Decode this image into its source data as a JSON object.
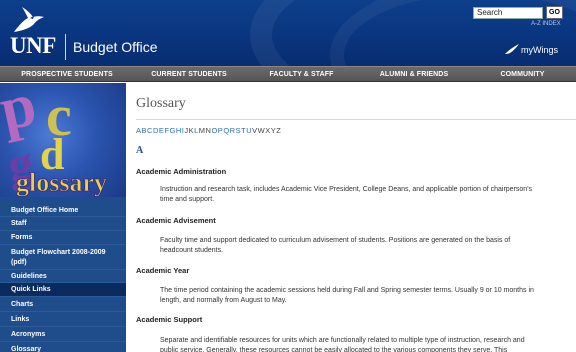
{
  "header": {
    "logo_text": "UNF",
    "site_title": "Budget Office",
    "search_value": "Search",
    "search_go": "GO",
    "az_index": "A-Z INDEX",
    "mywings": "myWings"
  },
  "nav": [
    "PROSPECTIVE STUDENTS",
    "CURRENT STUDENTS",
    "FACULTY & STAFF",
    "ALUMNI & FRIENDS",
    "COMMUNITY"
  ],
  "sidebar": {
    "banner_text": "glossary",
    "links": [
      "Budget Office Home",
      "Staff",
      "Forms",
      "Budget Flowchart 2008-2009 (pdf)",
      "Guidelines",
      "Quick Links",
      "Charts",
      "Links",
      "Acronyms",
      "Glossary"
    ],
    "highlighted": "Quick Links"
  },
  "main": {
    "title": "Glossary",
    "alphabet": [
      {
        "l": "A",
        "link": true
      },
      {
        "l": "B",
        "link": true
      },
      {
        "l": "C",
        "link": true
      },
      {
        "l": "D",
        "link": true
      },
      {
        "l": "E",
        "link": true
      },
      {
        "l": "F",
        "link": true
      },
      {
        "l": "G",
        "link": true
      },
      {
        "l": "H",
        "link": true
      },
      {
        "l": "I",
        "link": true
      },
      {
        "l": "J",
        "link": false
      },
      {
        "l": "K",
        "link": false
      },
      {
        "l": "L",
        "link": true
      },
      {
        "l": "M",
        "link": false
      },
      {
        "l": "N",
        "link": false
      },
      {
        "l": "O",
        "link": true
      },
      {
        "l": "P",
        "link": true
      },
      {
        "l": "Q",
        "link": true
      },
      {
        "l": "R",
        "link": true
      },
      {
        "l": "S",
        "link": true
      },
      {
        "l": "T",
        "link": true
      },
      {
        "l": "U",
        "link": true
      },
      {
        "l": "V",
        "link": false
      },
      {
        "l": "W",
        "link": false
      },
      {
        "l": "X",
        "link": false
      },
      {
        "l": "Y",
        "link": false
      },
      {
        "l": "Z",
        "link": false
      }
    ],
    "section_letter": "A",
    "terms": [
      {
        "term": "Academic Administration",
        "def": "Instruction and research task, includes Academic Vice President, College Deans, and applicable portion of chairperson's time and support."
      },
      {
        "term": "Academic Advisement",
        "def": "Faculty time and support dedicated to curriculum advisement of students. Positions are generated on the basis of headcount students."
      },
      {
        "term": "Academic Year",
        "def": "The time period containing the academic sessions held during Fall and Spring semester terms. Usually 9 or 10 months in length, and normally from August to May."
      },
      {
        "term": "Academic Support",
        "def": "Separate and identifiable resources for units which are functionally related to multiple type of instruction, research and public service. Generally, these resources cannot be easily allocated to the various components they serve. This"
      }
    ]
  }
}
